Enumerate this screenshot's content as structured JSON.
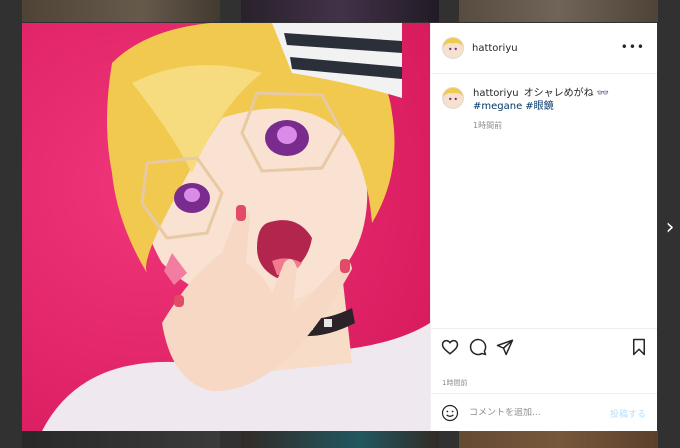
{
  "post": {
    "username": "hattoriyu",
    "caption_user": "hattoriyu",
    "caption_text": "オシャレめがね 👓",
    "hashtags": [
      "#megane",
      "#眼鏡"
    ],
    "caption_time": "1時間前",
    "post_time": "1時間前"
  },
  "header": {
    "more_label": "•••"
  },
  "comment_box": {
    "placeholder": "コメントを追加...",
    "post_label": "投稿する"
  },
  "nav": {
    "next_label": "›"
  },
  "colors": {
    "media_background": "#e8246a",
    "hashtag": "#00376b",
    "post_button_disabled": "#b2dffc"
  },
  "icons": {
    "like": "heart-icon",
    "comment": "comment-bubble-icon",
    "share": "paper-plane-icon",
    "save": "bookmark-icon",
    "emoji": "emoji-icon",
    "more": "more-dots-icon",
    "next": "chevron-right-icon"
  }
}
